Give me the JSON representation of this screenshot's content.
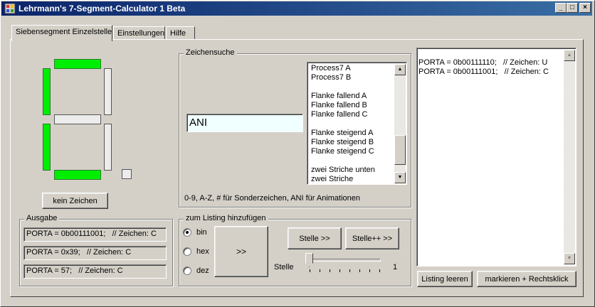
{
  "window": {
    "title": "Lehrmann's 7-Segment-Calculator 1 Beta",
    "minimize": "_",
    "maximize": "□",
    "close": "×"
  },
  "tabs": [
    {
      "label": "Siebensegment Einzelstelle",
      "active": true
    },
    {
      "label": "Einstellungen",
      "active": false
    },
    {
      "label": "Hilfe",
      "active": false
    }
  ],
  "display": {
    "segments": {
      "a": true,
      "b": false,
      "c": false,
      "d": true,
      "e": true,
      "f": true,
      "g": false,
      "dp": false
    },
    "on_color": "#00ee00",
    "off_color": "#ececec"
  },
  "kein_zeichen_button": "kein Zeichen",
  "ausgabe": {
    "label": "Ausgabe",
    "lines": [
      "PORTA = 0b00111001;   // Zeichen: C",
      "PORTA = 0x39;   // Zeichen: C",
      "PORTA = 57;   // Zeichen: C"
    ]
  },
  "zeichensuche": {
    "label": "Zeichensuche",
    "input_value": "ANI",
    "list_items": [
      "Process7 A",
      "Process7 B",
      "",
      "Flanke fallend A",
      "Flanke fallend B",
      "Flanke fallend C",
      "",
      "Flanke steigend A",
      "Flanke steigend B",
      "Flanke steigend C",
      "",
      "zwei Striche unten",
      "zwei Striche"
    ],
    "hint": "0-9,  A-Z, # für Sonderzeichen, ANI für Animationen",
    "scroll_up": "▲",
    "scroll_down": "▼"
  },
  "listing_add": {
    "label": "zum Listing hinzufügen",
    "radios": [
      {
        "label": "bin",
        "checked": true
      },
      {
        "label": "hex",
        "checked": false
      },
      {
        "label": "dez",
        "checked": false
      }
    ],
    "add_button": ">>",
    "stelle_button": "Stelle >>",
    "stelle_plus_button": "Stelle++ >>",
    "slider_label": "Stelle",
    "slider_value": "1",
    "slider_position": 0
  },
  "listing": {
    "lines": [
      "PORTA = 0b00111110;   // Zeichen: U",
      "PORTA = 0b00111001;   // Zeichen: C"
    ],
    "scroll_up": "▲",
    "scroll_down": "▼"
  },
  "listing_leeren_button": "Listing leeren",
  "markieren_button": "markieren + Rechtsklick"
}
